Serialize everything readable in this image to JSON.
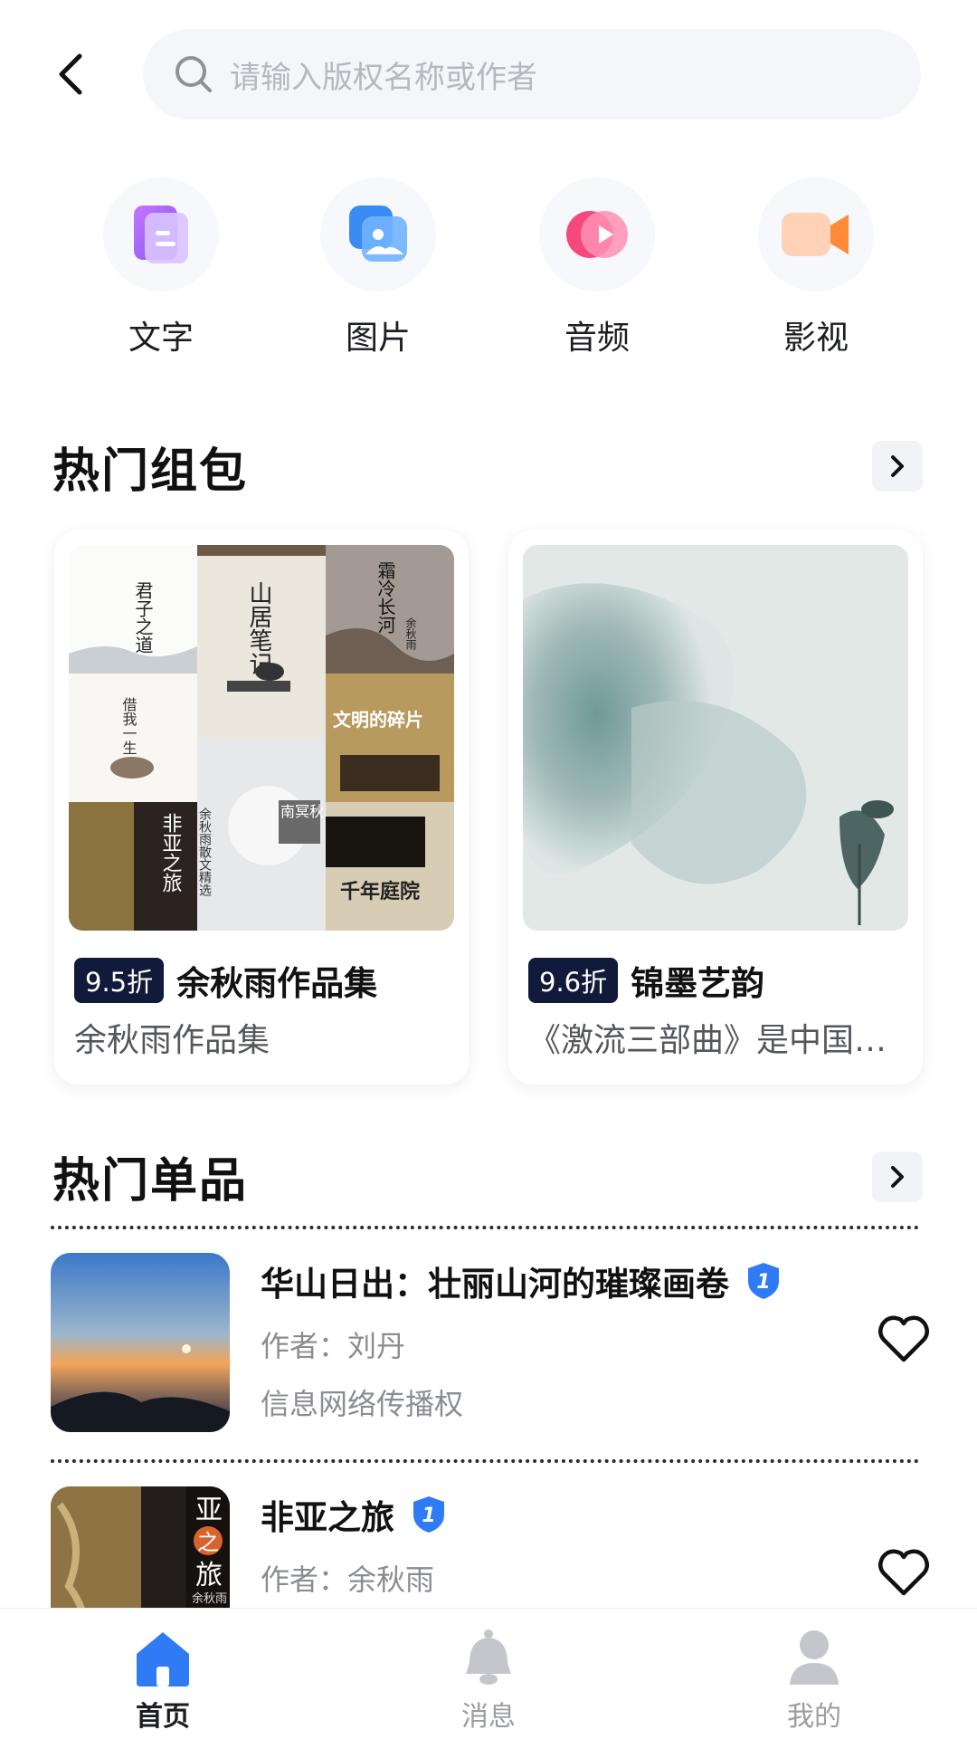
{
  "header": {
    "search_placeholder": "请输入版权名称或作者"
  },
  "categories": [
    {
      "label": "文字",
      "icon": "document-icon",
      "color": "#a86ef5"
    },
    {
      "label": "图片",
      "icon": "image-icon",
      "color": "#3b8cf2"
    },
    {
      "label": "音频",
      "icon": "audio-play-icon",
      "color": "#f5497e"
    },
    {
      "label": "影视",
      "icon": "video-camera-icon",
      "color": "#ff8a3a"
    }
  ],
  "hot_bundles": {
    "title": "热门组包",
    "items": [
      {
        "discount": "9.5折",
        "name": "余秋雨作品集",
        "desc": "余秋雨作品集",
        "cover_texts": [
          "君子之道",
          "山居笔记",
          "霜冷长河",
          "余秋雨",
          "借我一生",
          "文明的碎片",
          "非亚之旅",
          "余秋雨散文精选",
          "南冥秋水",
          "千年庭院"
        ]
      },
      {
        "discount": "9.6折",
        "name": "锦墨艺韵",
        "desc": "《激流三部曲》是中国…"
      }
    ]
  },
  "hot_singles": {
    "title": "热门单品",
    "items": [
      {
        "title": "华山日出：壮丽山河的璀璨画卷",
        "author": "作者：刘丹",
        "right_type": "信息网络传播权",
        "verified_badge": "1"
      },
      {
        "title": "非亚之旅",
        "author": "作者：余秋雨",
        "verified_badge": "1",
        "cover_texts": [
          "亚",
          "之",
          "旅",
          "余秋雨"
        ]
      }
    ]
  },
  "tabbar": [
    {
      "label": "首页",
      "icon": "home-icon",
      "active": true
    },
    {
      "label": "消息",
      "icon": "bell-icon",
      "active": false
    },
    {
      "label": "我的",
      "icon": "user-icon",
      "active": false
    }
  ],
  "colors": {
    "accent": "#2f7bf6",
    "badge_bg": "#111a3a"
  }
}
